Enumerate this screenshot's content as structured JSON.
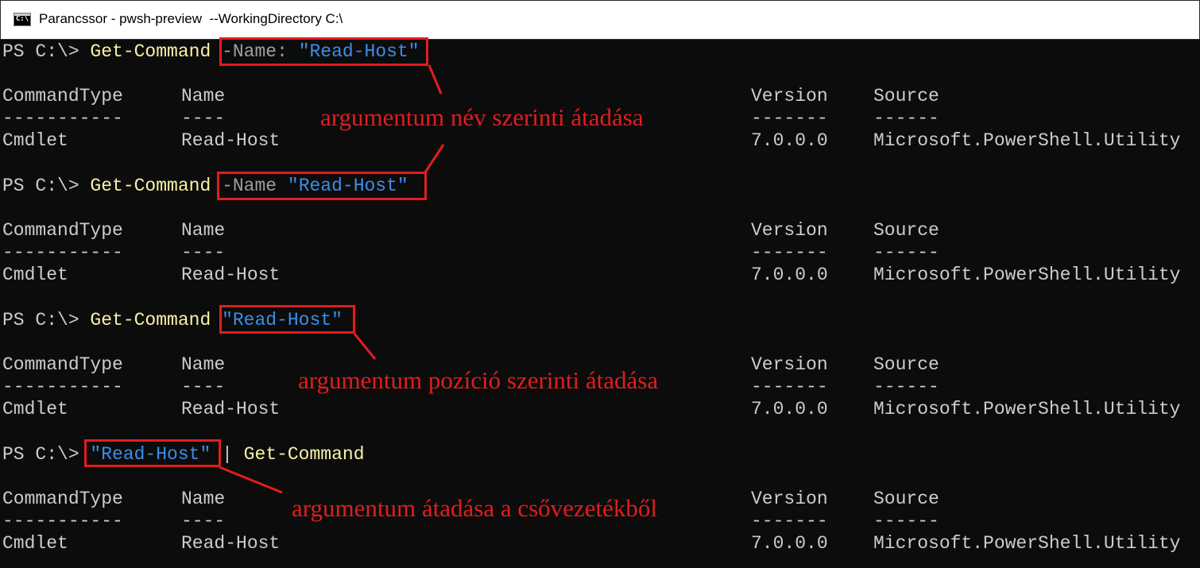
{
  "window": {
    "title": "Parancssor - pwsh-preview  --WorkingDirectory C:\\",
    "icon": "console-icon",
    "icon_text": "C:\\"
  },
  "blocks": [
    {
      "prompt": "PS C:\\> ",
      "command": [
        {
          "text": "Get-Command",
          "role": "cmdlet"
        },
        {
          "text": " ",
          "role": "plain"
        },
        {
          "text": "-Name:",
          "role": "param"
        },
        {
          "text": " ",
          "role": "plain"
        },
        {
          "text": "\"Read-Host\"",
          "role": "string"
        }
      ],
      "headers": [
        "CommandType",
        "Name",
        "Version",
        "Source"
      ],
      "dashes": [
        "-----------",
        "----",
        "-------",
        "------"
      ],
      "row": [
        "Cmdlet",
        "Read-Host",
        "7.0.0.0",
        "Microsoft.PowerShell.Utility"
      ]
    },
    {
      "prompt": "PS C:\\> ",
      "command": [
        {
          "text": "Get-Command",
          "role": "cmdlet"
        },
        {
          "text": " ",
          "role": "plain"
        },
        {
          "text": "-Name",
          "role": "param"
        },
        {
          "text": " ",
          "role": "plain"
        },
        {
          "text": "\"Read-Host\"",
          "role": "string"
        }
      ],
      "headers": [
        "CommandType",
        "Name",
        "Version",
        "Source"
      ],
      "dashes": [
        "-----------",
        "----",
        "-------",
        "------"
      ],
      "row": [
        "Cmdlet",
        "Read-Host",
        "7.0.0.0",
        "Microsoft.PowerShell.Utility"
      ]
    },
    {
      "prompt": "PS C:\\> ",
      "command": [
        {
          "text": "Get-Command",
          "role": "cmdlet"
        },
        {
          "text": " ",
          "role": "plain"
        },
        {
          "text": "\"Read-Host\"",
          "role": "string"
        }
      ],
      "headers": [
        "CommandType",
        "Name",
        "Version",
        "Source"
      ],
      "dashes": [
        "-----------",
        "----",
        "-------",
        "------"
      ],
      "row": [
        "Cmdlet",
        "Read-Host",
        "7.0.0.0",
        "Microsoft.PowerShell.Utility"
      ]
    },
    {
      "prompt": "PS C:\\> ",
      "command": [
        {
          "text": "\"Read-Host\"",
          "role": "string"
        },
        {
          "text": " | ",
          "role": "plain"
        },
        {
          "text": "Get-Command",
          "role": "cmdlet"
        }
      ],
      "headers": [
        "CommandType",
        "Name",
        "Version",
        "Source"
      ],
      "dashes": [
        "-----------",
        "----",
        "-------",
        "------"
      ],
      "row": [
        "Cmdlet",
        "Read-Host",
        "7.0.0.0",
        "Microsoft.PowerShell.Utility"
      ]
    }
  ],
  "annotations": {
    "by_name": "argumentum név szerinti átadása",
    "by_position": "argumentum pozíció szerinti átadása",
    "from_pipeline": "argumentum átadása a csővezetékből"
  },
  "colors": {
    "background": "#0c0c0c",
    "text": "#cccccc",
    "cmdlet": "#f9f1a5",
    "parameter": "#9e9e9e",
    "string": "#3b8eea",
    "annotation": "#e21d1d"
  }
}
